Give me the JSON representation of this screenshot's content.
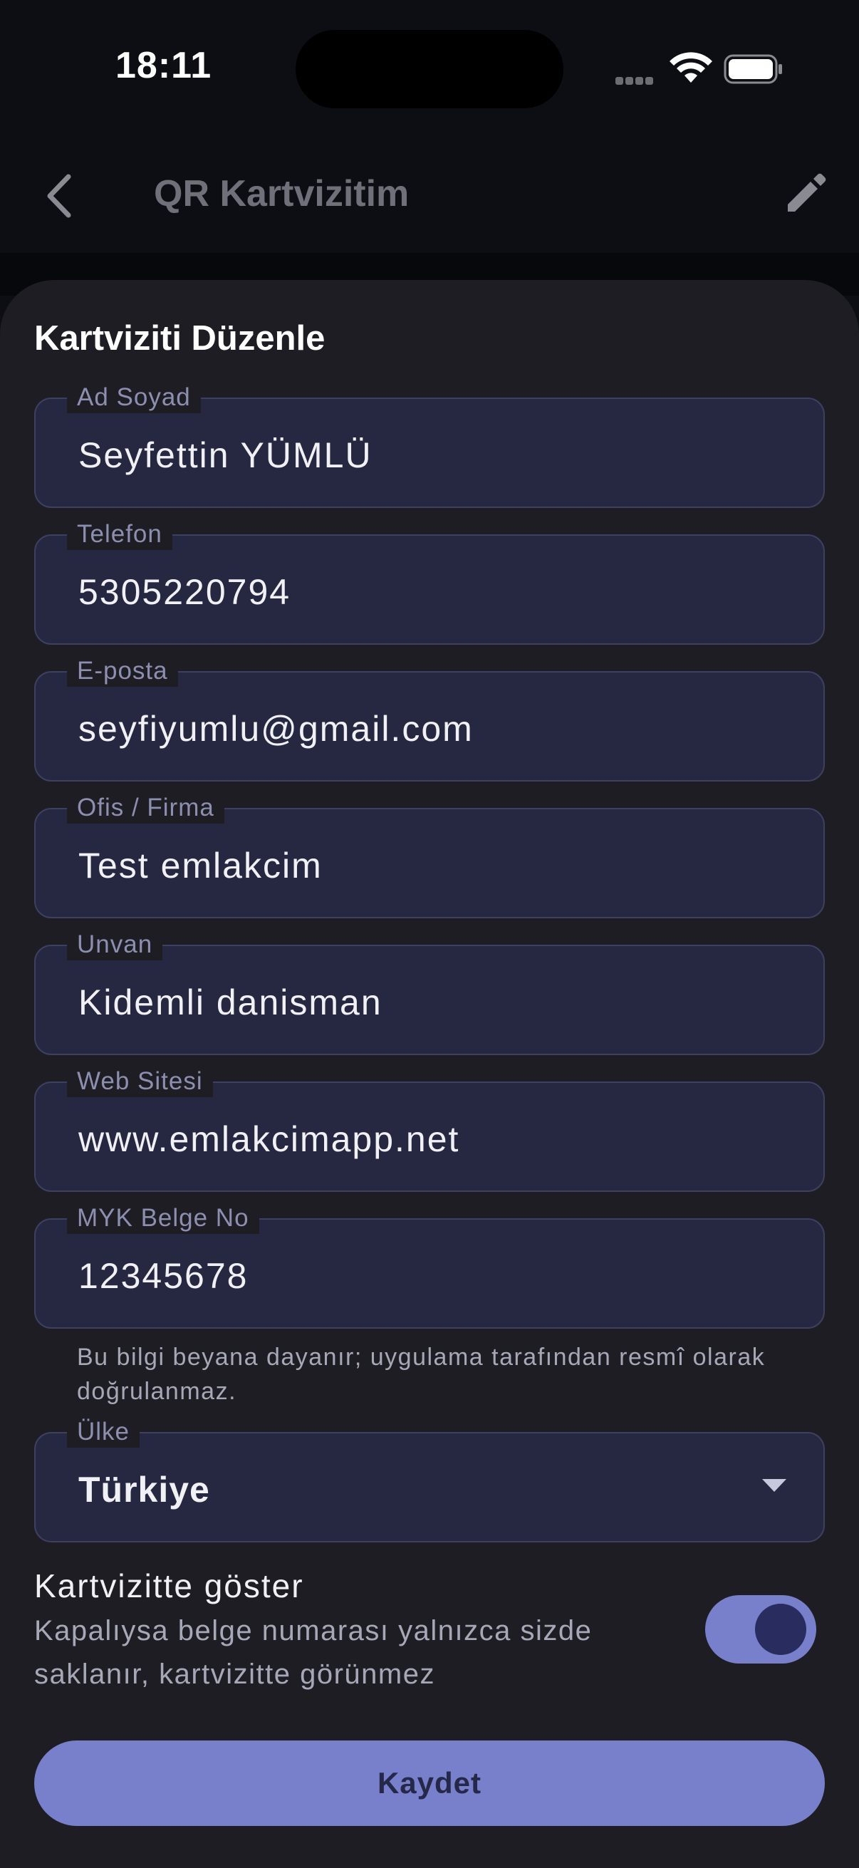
{
  "status_bar": {
    "time": "18:11"
  },
  "app_bar": {
    "title": "QR Kartvizitim",
    "back_icon": "chevron-left-icon",
    "edit_icon": "pencil-icon"
  },
  "sheet": {
    "title": "Kartviziti Düzenle",
    "fields": [
      {
        "label": "Ad Soyad",
        "value": "Seyfettin YÜMLÜ"
      },
      {
        "label": "Telefon",
        "value": "5305220794"
      },
      {
        "label": "E-posta",
        "value": "seyfiyumlu@gmail.com"
      },
      {
        "label": "Ofis / Firma",
        "value": "Test emlakcim"
      },
      {
        "label": "Unvan",
        "value": "Kidemli danisman"
      },
      {
        "label": "Web Sitesi",
        "value": "www.emlakcimapp.net"
      },
      {
        "label": "MYK Belge No",
        "value": "12345678"
      }
    ],
    "hint": "Bu bilgi beyana dayanır; uygulama tarafından resmî olarak doğrulanmaz.",
    "country": {
      "label": "Ülke",
      "value": "Türkiye"
    },
    "toggle": {
      "title": "Kartvizitte göster",
      "description": "Kapalıysa belge numarası yalnızca sizde saklanır, kartvizitte görünmez",
      "on": true
    },
    "save_label": "Kaydet"
  },
  "colors": {
    "accent": "#7880cb",
    "field_bg": "#262740",
    "sheet_bg": "#1d1d23"
  }
}
